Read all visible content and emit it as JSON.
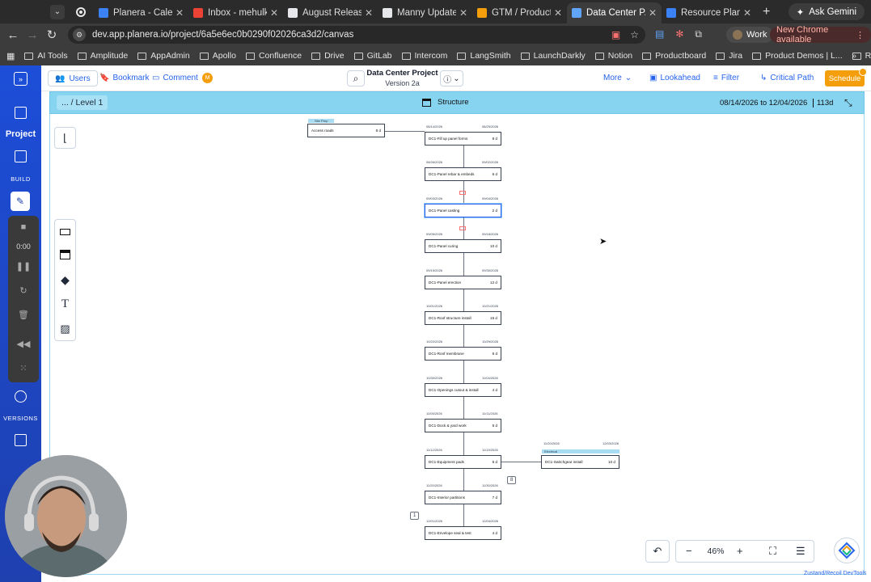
{
  "browser": {
    "tabs": [
      {
        "title": "Planera - Calendar",
        "color": "#3b82f6"
      },
      {
        "title": "Inbox - mehulk@...",
        "color": "#ea4335"
      },
      {
        "title": "August Release",
        "color": "#e5e7eb"
      },
      {
        "title": "Manny Update (A...",
        "color": "#e5e7eb"
      },
      {
        "title": "GTM / Product - ...",
        "color": "#f59e0b"
      },
      {
        "title": "Data Center P...",
        "color": "#60a5fa"
      },
      {
        "title": "Resource Plannin...",
        "color": "#3b82f6"
      }
    ],
    "active_tab_index": 5,
    "gemini_label": "Ask Gemini",
    "url": "dev.app.planera.io/project/6a5e6ec0b0290f02026ca3d2/canvas",
    "profile_label": "Work",
    "new_chrome_label": "New Chrome available",
    "bookmarks": [
      "AI Tools",
      "Amplitude",
      "AppAdmin",
      "Apollo",
      "Confluence",
      "Drive",
      "GitLab",
      "Intercom",
      "LangSmith",
      "LaunchDarkly",
      "Notion",
      "Productboard",
      "Jira",
      "Product Demos | L...",
      "Ramp"
    ]
  },
  "rail": {
    "project_label": "Project",
    "build_label": "BUILD",
    "timer": "0:00",
    "versions_label": "VERSIONS"
  },
  "toolbar": {
    "users_label": "Users",
    "bookmark_label": "Bookmark",
    "comment_label": "Comment",
    "avatar_initial": "M",
    "project_title": "Data Center Project",
    "version": "Version 2a",
    "more_label": "More",
    "lookahead_label": "Lookahead",
    "filter_label": "Filter",
    "critical_path_label": "Critical Path",
    "schedule_label": "Schedule"
  },
  "canvas_header": {
    "breadcrumb": "... / Level 1",
    "view_label": "Structure",
    "start_date": "08/14/2026",
    "to_label": "to",
    "end_date": "12/04/2026",
    "duration": "113d"
  },
  "canvas": {
    "zoom": "46%",
    "predecessor": {
      "group": "Site Prep",
      "name": "Access roads",
      "duration": "8 d"
    },
    "tasks": [
      {
        "name": "DC1-Fill up panel forms",
        "duration": "8 d",
        "start": "08/14/2026",
        "end": "08/25/2026"
      },
      {
        "name": "DC1-Panel rebar & embeds",
        "duration": "6 d",
        "start": "08/26/2026",
        "end": "09/02/2026"
      },
      {
        "name": "DC1-Panel casting",
        "duration": "2 d",
        "start": "09/03/2026",
        "end": "09/04/2026"
      },
      {
        "name": "DC1-Panel curing",
        "duration": "10 d",
        "start": "09/05/2026",
        "end": "09/18/2026"
      },
      {
        "name": "DC1-Panel erection",
        "duration": "12 d",
        "start": "09/15/2026",
        "end": "09/30/2026"
      },
      {
        "name": "DC1-Roof structure install",
        "duration": "15 d",
        "start": "10/01/2026",
        "end": "10/21/2026"
      },
      {
        "name": "DC1-Roof membrane",
        "duration": "6 d",
        "start": "10/22/2026",
        "end": "10/29/2026"
      },
      {
        "name": "DC1-Openings cutout & install",
        "duration": "4 d",
        "start": "10/30/2026",
        "end": "11/04/2026"
      },
      {
        "name": "DC1-Dock & yard work",
        "duration": "5 d",
        "start": "11/05/2026",
        "end": "11/11/2026"
      },
      {
        "name": "DC1-Equipment pads",
        "duration": "6 d",
        "start": "11/12/2026",
        "end": "11/19/2026"
      },
      {
        "name": "DC1-Interior partitions",
        "duration": "7 d",
        "start": "11/20/2026",
        "end": "11/30/2026"
      },
      {
        "name": "DC1-Envelope seal & test",
        "duration": "4 d",
        "start": "12/01/2026",
        "end": "12/04/2026"
      }
    ],
    "successor": {
      "group": "Electrical",
      "name": "DC1-Switchgear install",
      "duration": "10 d",
      "start": "11/20/2026",
      "end": "12/03/2026"
    },
    "badge_right": "8",
    "badge_left": "1"
  },
  "footer": {
    "devtools_label": "Zustand/Recoil DevTools"
  }
}
